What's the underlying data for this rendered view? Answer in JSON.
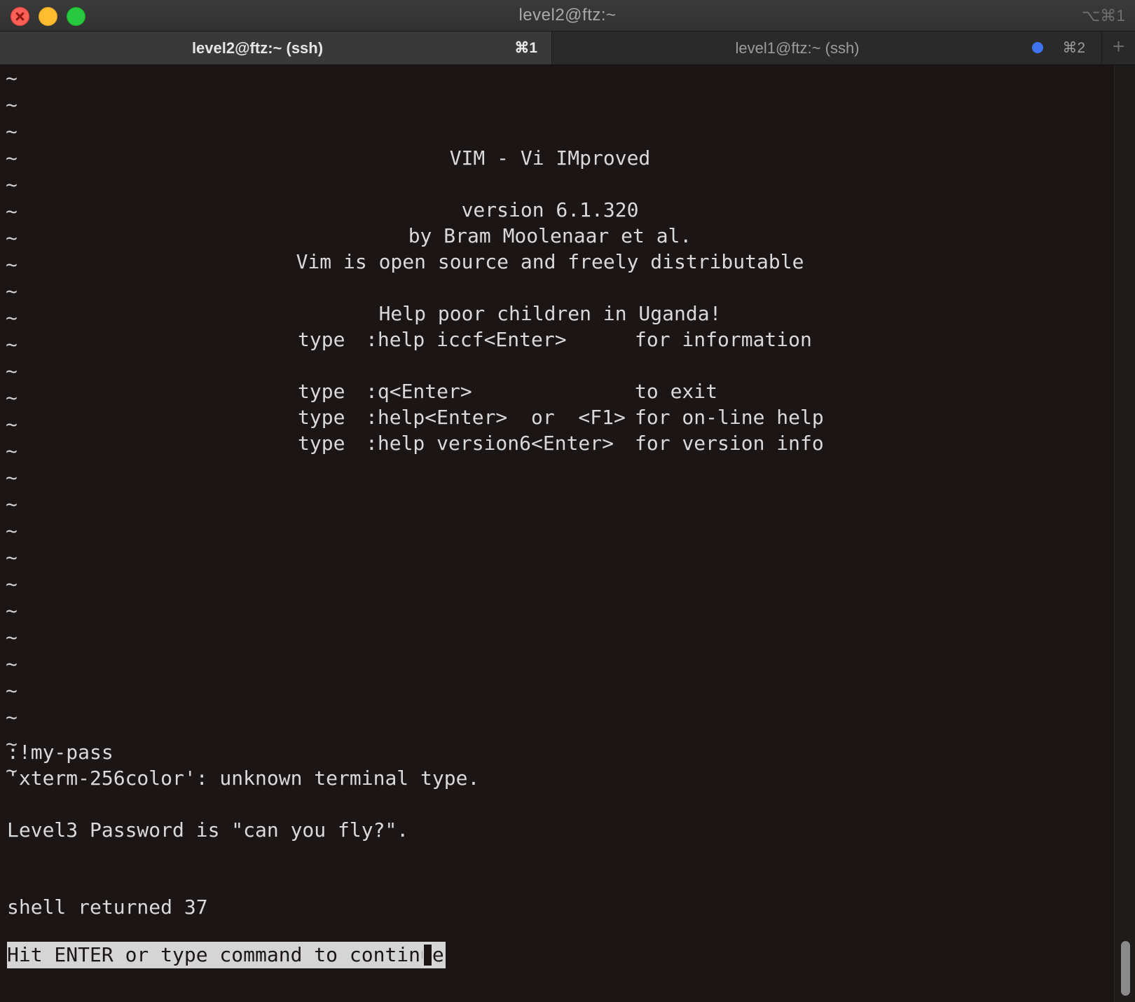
{
  "window": {
    "title": "level2@ftz:~",
    "title_shortcut": "⌥⌘1"
  },
  "tabs": [
    {
      "label": "level2@ftz:~ (ssh)",
      "shortcut": "⌘1",
      "active": true
    },
    {
      "label": "level1@ftz:~ (ssh)",
      "shortcut": "⌘2",
      "active": false,
      "activity_indicator_color": "#3f73f0"
    }
  ],
  "new_tab_icon": "plus-icon",
  "terminal": {
    "tilde": "~",
    "splash": {
      "title": "VIM - Vi IMproved",
      "version": "version 6.1.320",
      "author": "by Bram Moolenaar et al.",
      "license": "Vim is open source and freely distributable",
      "charity": "Help poor children in Uganda!",
      "help_rows": [
        {
          "verb": "type",
          "command": ":help iccf<Enter>",
          "desc": "for information"
        },
        {
          "verb": "type",
          "command": ":q<Enter>",
          "desc": "to exit"
        },
        {
          "verb": "type",
          "command": ":help<Enter>  or  <F1>",
          "desc": "for on-line help"
        },
        {
          "verb": "type",
          "command": ":help version6<Enter>",
          "desc": "for version info"
        }
      ]
    },
    "output": {
      "command": ":!my-pass",
      "warning": "'xterm-256color': unknown terminal type.",
      "password_line": "Level3 Password is \"can you fly?\".",
      "shell_return": "shell returned 37",
      "prompt": "Hit ENTER or type command to continue"
    }
  },
  "colors": {
    "background": "#1b1615",
    "foreground": "#d9d9d9",
    "prompt_highlight": "#d5d5d5"
  }
}
